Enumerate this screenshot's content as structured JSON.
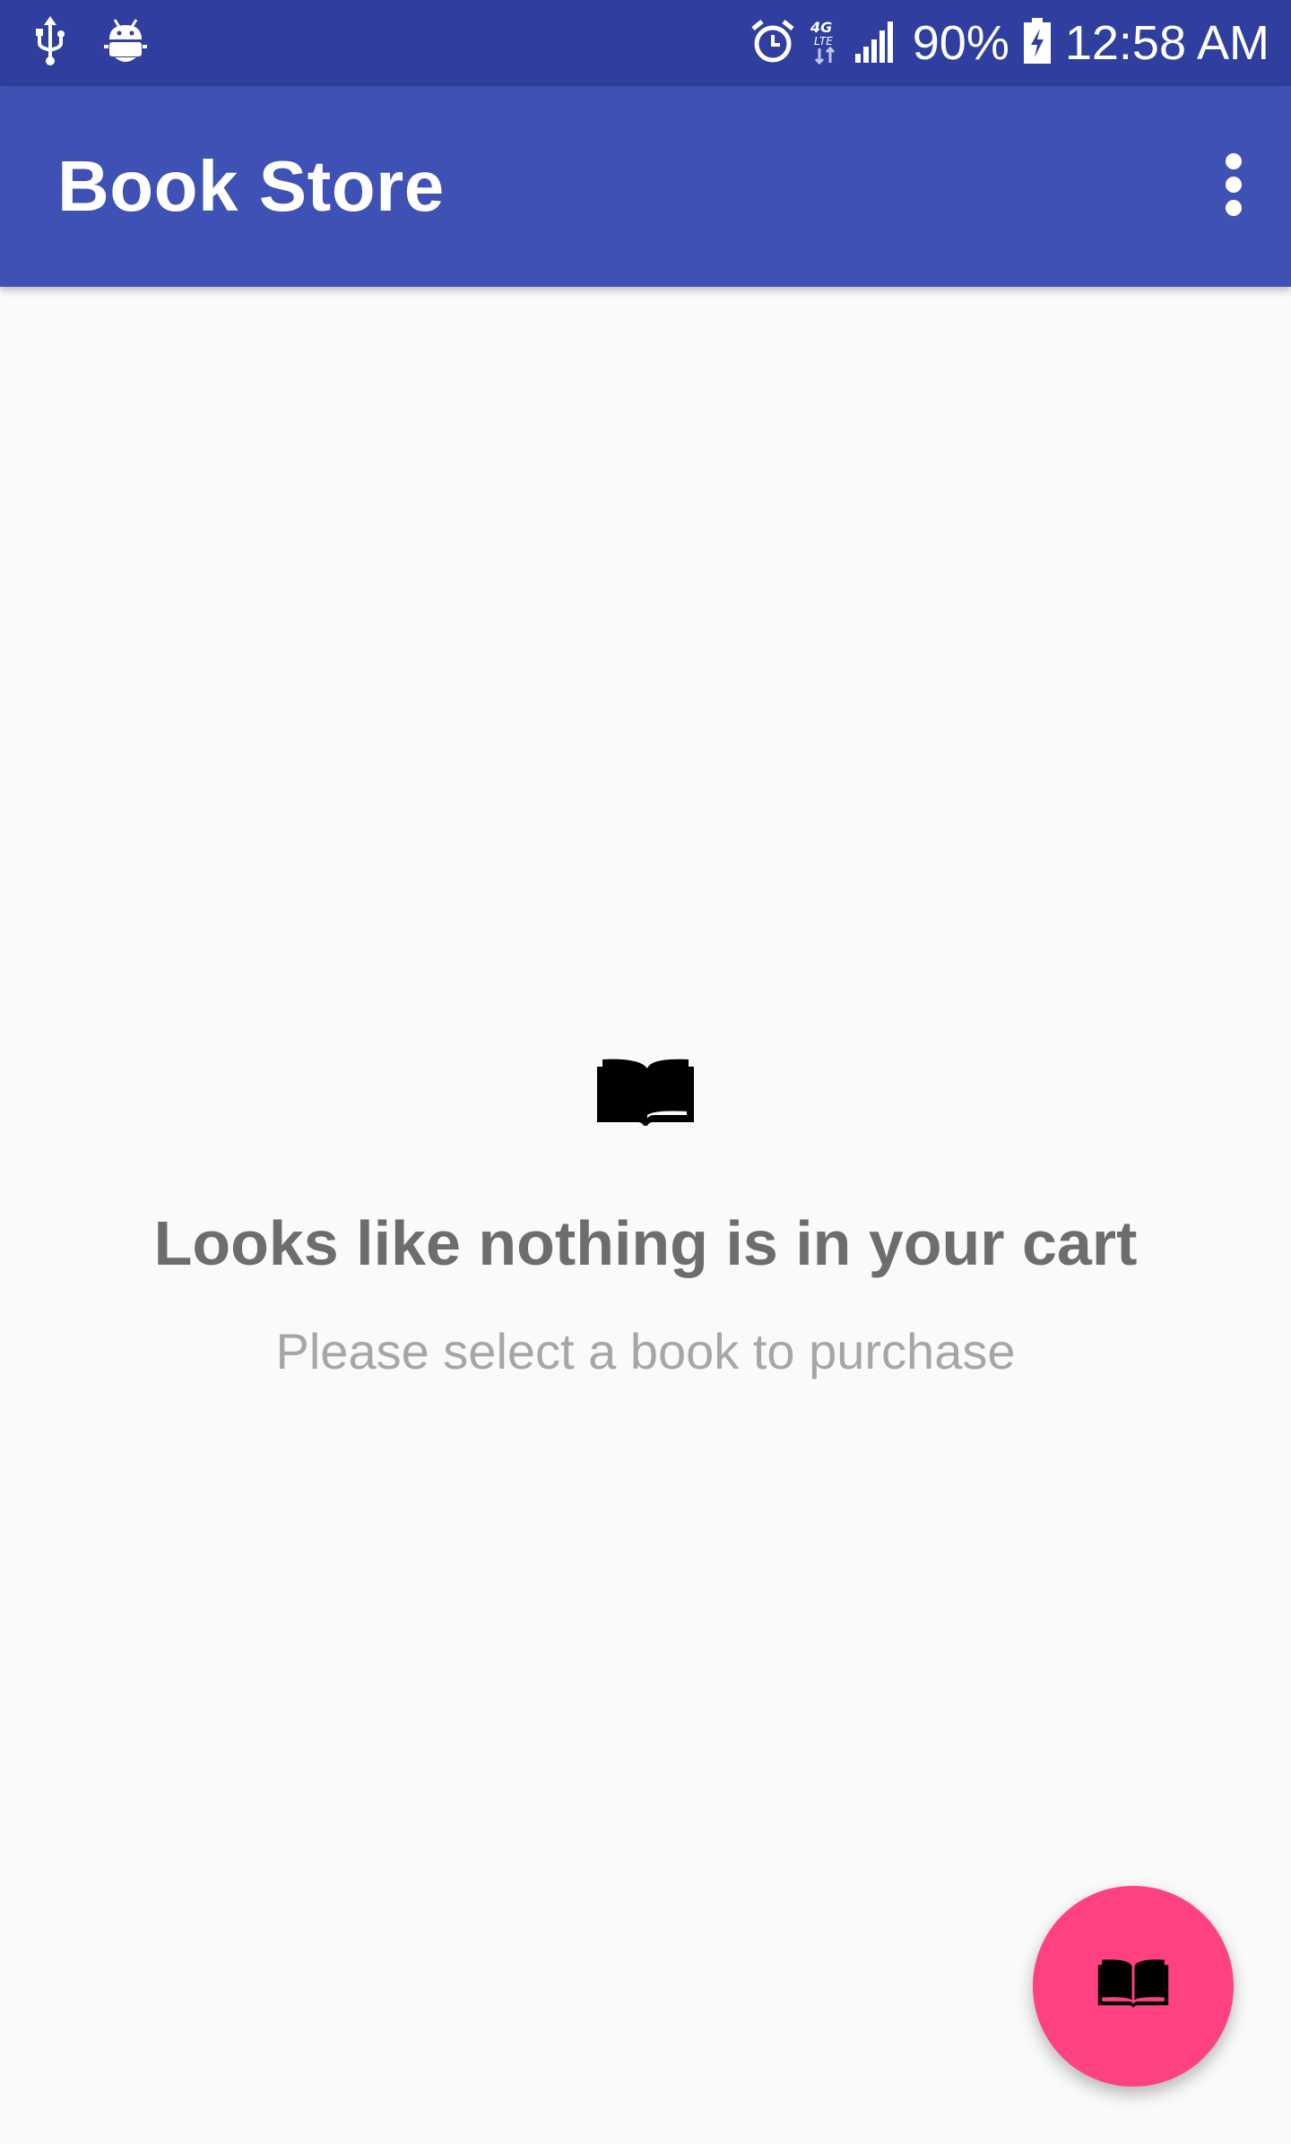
{
  "status_bar": {
    "battery": "90%",
    "time": "12:58 AM",
    "network": "4G LTE",
    "icons": [
      "usb-icon",
      "android-debug-icon",
      "alarm-icon",
      "4g-lte-icon",
      "signal-icon",
      "battery-charging-icon"
    ]
  },
  "app_bar": {
    "title": "Book Store",
    "menu_icon": "more-vert-icon"
  },
  "empty_state": {
    "icon": "open-book-icon",
    "title": "Looks like nothing is in your cart",
    "subtitle": "Please select a book to purchase"
  },
  "fab": {
    "icon": "open-book-icon"
  },
  "colors": {
    "status_bar": "#303f9f",
    "primary": "#3f51b5",
    "accent": "#ff4081",
    "background": "#fafafa",
    "title_text": "#6d6d6d",
    "subtitle_text": "#a6a6a6"
  }
}
